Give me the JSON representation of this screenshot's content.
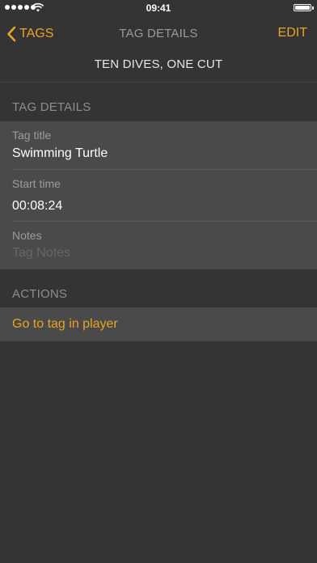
{
  "status_bar": {
    "time": "09:41"
  },
  "nav": {
    "back_label": "TAGS",
    "title": "TAG DETAILS",
    "edit_label": "EDIT"
  },
  "subtitle": "TEN DIVES, ONE CUT",
  "tag_details": {
    "header": "TAG DETAILS",
    "title_label": "Tag title",
    "title_value": "Swimming Turtle",
    "start_label": "Start time",
    "start_value": "00:08:24",
    "notes_label": "Notes",
    "notes_placeholder": "Tag Notes"
  },
  "actions": {
    "header": "ACTIONS",
    "go_to_player": "Go to tag in player"
  },
  "colors": {
    "accent": "#e8a425",
    "background": "#343434",
    "cell": "#4a4a4a"
  }
}
